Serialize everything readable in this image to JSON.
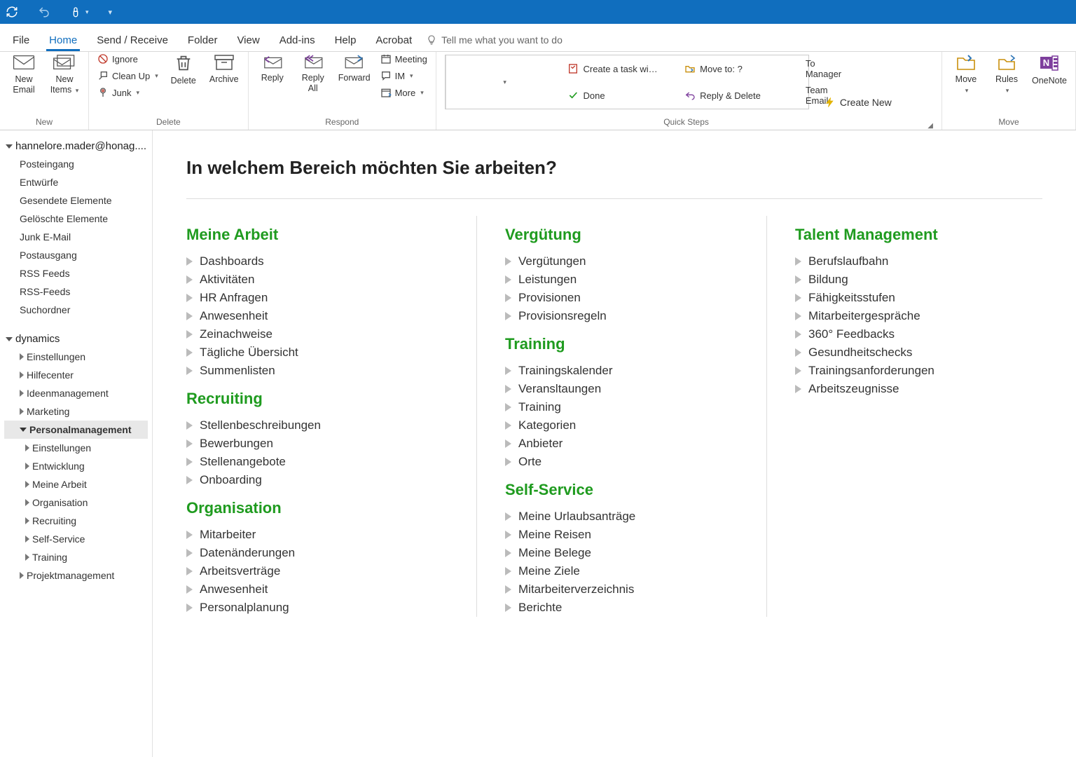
{
  "menubar": {
    "file": "File",
    "home": "Home",
    "sendreceive": "Send / Receive",
    "folder": "Folder",
    "view": "View",
    "addins": "Add-ins",
    "help": "Help",
    "acrobat": "Acrobat",
    "tellme": "Tell me what you want to do"
  },
  "ribbon": {
    "newEmail": "New\nEmail",
    "newItems": "New\nItems",
    "newGrp": "New",
    "ignore": "Ignore",
    "cleanup": "Clean Up",
    "junk": "Junk",
    "delete": "Delete",
    "archive": "Archive",
    "deleteGrp": "Delete",
    "reply": "Reply",
    "replyAll": "Reply\nAll",
    "forward": "Forward",
    "meeting": "Meeting",
    "im": "IM",
    "more": "More",
    "respondGrp": "Respond",
    "qs": {
      "createTask": "Create a task wi…",
      "moveTo": "Move to: ?",
      "toManager": "To Manager",
      "done": "Done",
      "replyDelete": "Reply & Delete",
      "teamEmail": "Team Email",
      "createNew": "Create New"
    },
    "qsGrp": "Quick Steps",
    "move": "Move",
    "rules": "Rules",
    "onenote": "OneNote",
    "moveGrp": "Move"
  },
  "nav": {
    "account": "hannelore.mader@honag....",
    "mail": [
      "Posteingang",
      "Entwürfe",
      "Gesendete Elemente",
      "Gelöschte Elemente",
      "Junk E-Mail",
      "Postausgang",
      "RSS Feeds",
      "RSS-Feeds",
      "Suchordner"
    ],
    "dynamics": "dynamics",
    "dynTop": [
      "Einstellungen",
      "Hilfecenter",
      "Ideenmanagement",
      "Marketing"
    ],
    "selected": "Personalmanagement",
    "dynSub": [
      "Einstellungen",
      "Entwicklung",
      "Meine Arbeit",
      "Organisation",
      "Recruiting",
      "Self-Service",
      "Training"
    ],
    "dynAfter": [
      "Projektmanagement"
    ]
  },
  "content": {
    "heading": "In welchem Bereich möchten Sie arbeiten?",
    "col1": [
      {
        "title": "Meine Arbeit",
        "items": [
          "Dashboards",
          "Aktivitäten",
          "HR Anfragen",
          "Anwesenheit",
          "Zeinachweise",
          "Tägliche Übersicht",
          "Summenlisten"
        ]
      },
      {
        "title": "Recruiting",
        "items": [
          "Stellenbeschreibungen",
          "Bewerbungen",
          "Stellenangebote",
          "Onboarding"
        ]
      },
      {
        "title": "Organisation",
        "items": [
          "Mitarbeiter",
          "Datenänderungen",
          "Arbeitsverträge",
          "Anwesenheit",
          "Personalplanung"
        ]
      }
    ],
    "col2": [
      {
        "title": "Vergütung",
        "items": [
          "Vergütungen",
          "Leistungen",
          "Provisionen",
          "Provisionsregeln"
        ]
      },
      {
        "title": "Training",
        "items": [
          "Trainingskalender",
          "Veransltaungen",
          "Training",
          "Kategorien",
          "Anbieter",
          "Orte"
        ]
      },
      {
        "title": "Self-Service",
        "items": [
          "Meine Urlaubsanträge",
          "Meine Reisen",
          "Meine Belege",
          "Meine Ziele",
          "Mitarbeiterverzeichnis",
          "Berichte"
        ]
      }
    ],
    "col3": [
      {
        "title": "Talent Management",
        "items": [
          "Berufslaufbahn",
          "Bildung",
          "Fähigkeitsstufen",
          "Mitarbeitergespräche",
          "360° Feedbacks",
          "Gesundheitschecks",
          "Trainingsanforderungen",
          "Arbeitszeugnisse"
        ]
      }
    ]
  }
}
